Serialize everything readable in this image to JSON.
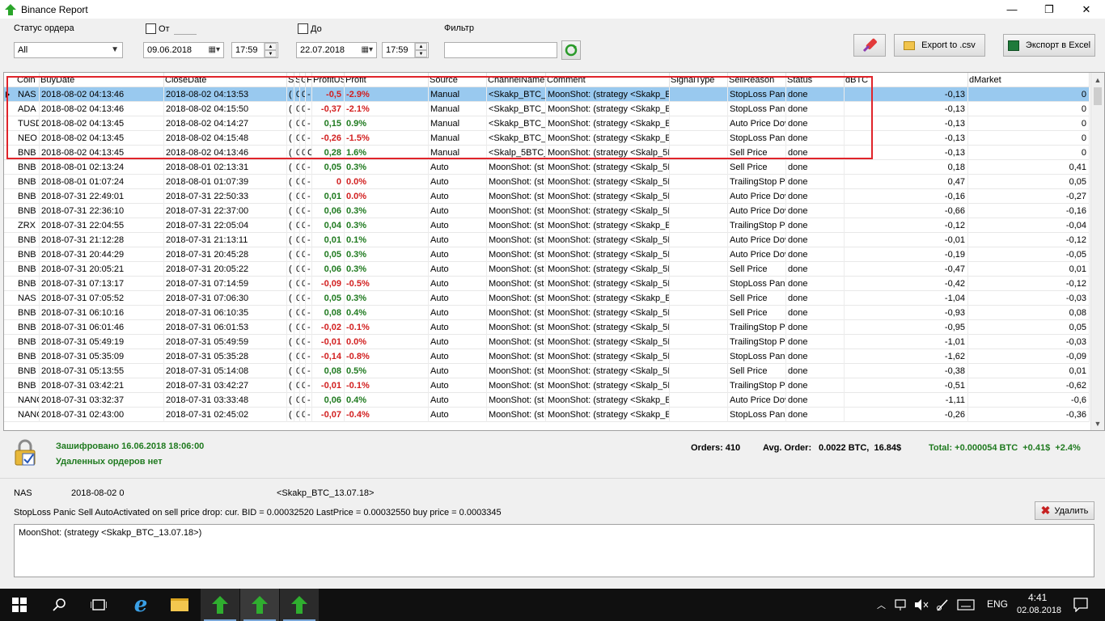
{
  "window": {
    "title": "Binance Report",
    "min_glyph": "—",
    "max_glyph": "❐",
    "close_glyph": "✕"
  },
  "toolbar": {
    "order_status_label": "Статус ордера",
    "order_status_value": "All",
    "from_label": "От",
    "from_date": "09.06.2018",
    "from_time": "17:59",
    "to_label": "До",
    "to_date": "22.07.2018",
    "to_time": "17:59",
    "filter_label": "Фильтр",
    "filter_value": "",
    "export_csv_label": "Export to .csv",
    "export_excel_label": "Экспорт в Excel"
  },
  "grid": {
    "columns": [
      "Coin",
      "BuyDate",
      "CloseDate",
      "S",
      "S",
      "G",
      "F",
      "ProfitUS",
      "Profit",
      "Source",
      "ChannelName",
      "Comment",
      "SignalType",
      "SellReason",
      "Status",
      "dBTC",
      "dMarket"
    ],
    "rows": [
      {
        "coin": "NAS",
        "buy": "2018-08-02 04:13:46",
        "close": "2018-08-02 04:13:53",
        "s1": "(",
        "s2": "0",
        "g": "0",
        "f": "-",
        "pus": "-0,5",
        "profit": "-2.9%",
        "source": "Manual",
        "channel": "<Skakp_BTC_",
        "comment": "MoonShot: (strategy <Skakp_E",
        "signal": "",
        "reason": "StopLoss Panic",
        "status": "done",
        "dbtc": "-0,13",
        "dmarket": "0",
        "sign": "neg",
        "selected": true
      },
      {
        "coin": "ADA",
        "buy": "2018-08-02 04:13:46",
        "close": "2018-08-02 04:15:50",
        "s1": "(",
        "s2": "0",
        "g": "0",
        "f": "-",
        "pus": "-0,37",
        "profit": "-2.1%",
        "source": "Manual",
        "channel": "<Skakp_BTC_",
        "comment": "MoonShot: (strategy <Skakp_E",
        "signal": "",
        "reason": "StopLoss Panic",
        "status": "done",
        "dbtc": "-0,13",
        "dmarket": "0",
        "sign": "neg"
      },
      {
        "coin": "TUSD",
        "buy": "2018-08-02 04:13:45",
        "close": "2018-08-02 04:14:27",
        "s1": "(",
        "s2": "0",
        "g": "0",
        "f": "-",
        "pus": "0,15",
        "profit": "0.9%",
        "source": "Manual",
        "channel": "<Skakp_BTC_",
        "comment": "MoonShot: (strategy <Skakp_E",
        "signal": "",
        "reason": "Auto Price Dov",
        "status": "done",
        "dbtc": "-0,13",
        "dmarket": "0",
        "sign": "pos"
      },
      {
        "coin": "NEO",
        "buy": "2018-08-02 04:13:45",
        "close": "2018-08-02 04:15:48",
        "s1": "(",
        "s2": "0",
        "g": "0",
        "f": "-",
        "pus": "-0,26",
        "profit": "-1.5%",
        "source": "Manual",
        "channel": "<Skakp_BTC_",
        "comment": "MoonShot: (strategy <Skakp_E",
        "signal": "",
        "reason": "StopLoss Panic",
        "status": "done",
        "dbtc": "-0,13",
        "dmarket": "0",
        "sign": "neg"
      },
      {
        "coin": "BNB",
        "buy": "2018-08-02 04:13:45",
        "close": "2018-08-02 04:13:46",
        "s1": "(",
        "s2": "0",
        "g": "0",
        "f": "C",
        "pus": "0,28",
        "profit": "1.6%",
        "source": "Manual",
        "channel": "<Skalp_5BTC_",
        "comment": "MoonShot: (strategy <Skalp_5I",
        "signal": "",
        "reason": "Sell Price",
        "status": "done",
        "dbtc": "-0,13",
        "dmarket": "0",
        "sign": "pos"
      },
      {
        "coin": "BNB",
        "buy": "2018-08-01 02:13:24",
        "close": "2018-08-01 02:13:31",
        "s1": "(",
        "s2": "0",
        "g": "0",
        "f": "-",
        "pus": "0,05",
        "profit": "0.3%",
        "source": "Auto",
        "channel": "MoonShot: (st",
        "comment": "MoonShot: (strategy <Skalp_5I",
        "signal": "",
        "reason": "Sell Price",
        "status": "done",
        "dbtc": "0,18",
        "dmarket": "0,41",
        "sign": "pos"
      },
      {
        "coin": "BNB",
        "buy": "2018-08-01 01:07:24",
        "close": "2018-08-01 01:07:39",
        "s1": "(",
        "s2": "0",
        "g": "0",
        "f": "-",
        "pus": "0",
        "profit": "0.0%",
        "source": "Auto",
        "channel": "MoonShot: (st",
        "comment": "MoonShot: (strategy <Skalp_5I",
        "signal": "",
        "reason": "TrailingStop Pa",
        "status": "done",
        "dbtc": "0,47",
        "dmarket": "0,05",
        "sign": "neg"
      },
      {
        "coin": "BNB",
        "buy": "2018-07-31 22:49:01",
        "close": "2018-07-31 22:50:33",
        "s1": "(",
        "s2": "0",
        "g": "0",
        "f": "-",
        "pus": "0,01",
        "profit": "0.0%",
        "source": "Auto",
        "channel": "MoonShot: (st",
        "comment": "MoonShot: (strategy <Skalp_5I",
        "signal": "",
        "reason": "Auto Price Dov",
        "status": "done",
        "dbtc": "-0,16",
        "dmarket": "-0,27",
        "sign": "pos",
        "profit_neg": true
      },
      {
        "coin": "BNB",
        "buy": "2018-07-31 22:36:10",
        "close": "2018-07-31 22:37:00",
        "s1": "(",
        "s2": "0",
        "g": "0",
        "f": "-",
        "pus": "0,06",
        "profit": "0.3%",
        "source": "Auto",
        "channel": "MoonShot: (st",
        "comment": "MoonShot: (strategy <Skalp_5I",
        "signal": "",
        "reason": "Auto Price Dov",
        "status": "done",
        "dbtc": "-0,66",
        "dmarket": "-0,16",
        "sign": "pos"
      },
      {
        "coin": "ZRX",
        "buy": "2018-07-31 22:04:55",
        "close": "2018-07-31 22:05:04",
        "s1": "(",
        "s2": "0",
        "g": "0",
        "f": "-",
        "pus": "0,04",
        "profit": "0.3%",
        "source": "Auto",
        "channel": "MoonShot: (st",
        "comment": "MoonShot: (strategy <Skakp_E",
        "signal": "",
        "reason": "TrailingStop Pa",
        "status": "done",
        "dbtc": "-0,12",
        "dmarket": "-0,04",
        "sign": "pos"
      },
      {
        "coin": "BNB",
        "buy": "2018-07-31 21:12:28",
        "close": "2018-07-31 21:13:11",
        "s1": "(",
        "s2": "0",
        "g": "0",
        "f": "-",
        "pus": "0,01",
        "profit": "0.1%",
        "source": "Auto",
        "channel": "MoonShot: (st",
        "comment": "MoonShot: (strategy <Skalp_5I",
        "signal": "",
        "reason": "Auto Price Dov",
        "status": "done",
        "dbtc": "-0,01",
        "dmarket": "-0,12",
        "sign": "pos"
      },
      {
        "coin": "BNB",
        "buy": "2018-07-31 20:44:29",
        "close": "2018-07-31 20:45:28",
        "s1": "(",
        "s2": "0",
        "g": "0",
        "f": "-",
        "pus": "0,05",
        "profit": "0.3%",
        "source": "Auto",
        "channel": "MoonShot: (st",
        "comment": "MoonShot: (strategy <Skalp_5I",
        "signal": "",
        "reason": "Auto Price Dov",
        "status": "done",
        "dbtc": "-0,19",
        "dmarket": "-0,05",
        "sign": "pos"
      },
      {
        "coin": "BNB",
        "buy": "2018-07-31 20:05:21",
        "close": "2018-07-31 20:05:22",
        "s1": "(",
        "s2": "0",
        "g": "0",
        "f": "-",
        "pus": "0,06",
        "profit": "0.3%",
        "source": "Auto",
        "channel": "MoonShot: (st",
        "comment": "MoonShot: (strategy <Skalp_5I",
        "signal": "",
        "reason": "Sell Price",
        "status": "done",
        "dbtc": "-0,47",
        "dmarket": "0,01",
        "sign": "pos"
      },
      {
        "coin": "BNB",
        "buy": "2018-07-31 07:13:17",
        "close": "2018-07-31 07:14:59",
        "s1": "(",
        "s2": "0",
        "g": "0",
        "f": "-",
        "pus": "-0,09",
        "profit": "-0.5%",
        "source": "Auto",
        "channel": "MoonShot: (st",
        "comment": "MoonShot: (strategy <Skalp_5I",
        "signal": "",
        "reason": "StopLoss Panic",
        "status": "done",
        "dbtc": "-0,42",
        "dmarket": "-0,12",
        "sign": "neg"
      },
      {
        "coin": "NAS",
        "buy": "2018-07-31 07:05:52",
        "close": "2018-07-31 07:06:30",
        "s1": "(",
        "s2": "0",
        "g": "0",
        "f": "-",
        "pus": "0,05",
        "profit": "0.3%",
        "source": "Auto",
        "channel": "MoonShot: (st",
        "comment": "MoonShot: (strategy <Skakp_E",
        "signal": "",
        "reason": "Sell Price",
        "status": "done",
        "dbtc": "-1,04",
        "dmarket": "-0,03",
        "sign": "pos"
      },
      {
        "coin": "BNB",
        "buy": "2018-07-31 06:10:16",
        "close": "2018-07-31 06:10:35",
        "s1": "(",
        "s2": "0",
        "g": "0",
        "f": "-",
        "pus": "0,08",
        "profit": "0.4%",
        "source": "Auto",
        "channel": "MoonShot: (st",
        "comment": "MoonShot: (strategy <Skalp_5I",
        "signal": "",
        "reason": "Sell Price",
        "status": "done",
        "dbtc": "-0,93",
        "dmarket": "0,08",
        "sign": "pos"
      },
      {
        "coin": "BNB",
        "buy": "2018-07-31 06:01:46",
        "close": "2018-07-31 06:01:53",
        "s1": "(",
        "s2": "0",
        "g": "0",
        "f": "-",
        "pus": "-0,02",
        "profit": "-0.1%",
        "source": "Auto",
        "channel": "MoonShot: (st",
        "comment": "MoonShot: (strategy <Skalp_5I",
        "signal": "",
        "reason": "TrailingStop Pa",
        "status": "done",
        "dbtc": "-0,95",
        "dmarket": "0,05",
        "sign": "neg"
      },
      {
        "coin": "BNB",
        "buy": "2018-07-31 05:49:19",
        "close": "2018-07-31 05:49:59",
        "s1": "(",
        "s2": "0",
        "g": "0",
        "f": "-",
        "pus": "-0,01",
        "profit": "0.0%",
        "source": "Auto",
        "channel": "MoonShot: (st",
        "comment": "MoonShot: (strategy <Skalp_5I",
        "signal": "",
        "reason": "TrailingStop Pa",
        "status": "done",
        "dbtc": "-1,01",
        "dmarket": "-0,03",
        "sign": "neg"
      },
      {
        "coin": "BNB",
        "buy": "2018-07-31 05:35:09",
        "close": "2018-07-31 05:35:28",
        "s1": "(",
        "s2": "0",
        "g": "0",
        "f": "-",
        "pus": "-0,14",
        "profit": "-0.8%",
        "source": "Auto",
        "channel": "MoonShot: (st",
        "comment": "MoonShot: (strategy <Skalp_5I",
        "signal": "",
        "reason": "StopLoss Panic",
        "status": "done",
        "dbtc": "-1,62",
        "dmarket": "-0,09",
        "sign": "neg"
      },
      {
        "coin": "BNB",
        "buy": "2018-07-31 05:13:55",
        "close": "2018-07-31 05:14:08",
        "s1": "(",
        "s2": "0",
        "g": "0",
        "f": "-",
        "pus": "0,08",
        "profit": "0.5%",
        "source": "Auto",
        "channel": "MoonShot: (st",
        "comment": "MoonShot: (strategy <Skalp_5I",
        "signal": "",
        "reason": "Sell Price",
        "status": "done",
        "dbtc": "-0,38",
        "dmarket": "0,01",
        "sign": "pos"
      },
      {
        "coin": "BNB",
        "buy": "2018-07-31 03:42:21",
        "close": "2018-07-31 03:42:27",
        "s1": "(",
        "s2": "0",
        "g": "0",
        "f": "-",
        "pus": "-0,01",
        "profit": "-0.1%",
        "source": "Auto",
        "channel": "MoonShot: (st",
        "comment": "MoonShot: (strategy <Skalp_5I",
        "signal": "",
        "reason": "TrailingStop Pa",
        "status": "done",
        "dbtc": "-0,51",
        "dmarket": "-0,62",
        "sign": "neg"
      },
      {
        "coin": "NANC",
        "buy": "2018-07-31 03:32:37",
        "close": "2018-07-31 03:33:48",
        "s1": "(",
        "s2": "0",
        "g": "0",
        "f": "-",
        "pus": "0,06",
        "profit": "0.4%",
        "source": "Auto",
        "channel": "MoonShot: (st",
        "comment": "MoonShot: (strategy <Skakp_E",
        "signal": "",
        "reason": "Auto Price Dov",
        "status": "done",
        "dbtc": "-1,11",
        "dmarket": "-0,6",
        "sign": "pos"
      },
      {
        "coin": "NANC",
        "buy": "2018-07-31 02:43:00",
        "close": "2018-07-31 02:45:02",
        "s1": "(",
        "s2": "0",
        "g": "0",
        "f": "-",
        "pus": "-0,07",
        "profit": "-0.4%",
        "source": "Auto",
        "channel": "MoonShot: (st",
        "comment": "MoonShot: (strategy <Skakp_E",
        "signal": "",
        "reason": "StopLoss Panic",
        "status": "done",
        "dbtc": "-0,26",
        "dmarket": "-0,36",
        "sign": "neg"
      }
    ]
  },
  "status": {
    "encrypted": "Зашифровано 16.06.2018 18:06:00",
    "deleted": "Удаленных ордеров нет",
    "orders_label": "Orders: 410",
    "avg_label": "Avg. Order:",
    "avg_value": "0.0022 BTC,  16.84$",
    "total": "Total: +0.000054 BTC  +0.41$  +2.4%"
  },
  "detail": {
    "coin": "NAS",
    "date": "2018-08-02 0",
    "channel": "<Skakp_BTC_13.07.18>",
    "reason_text": "StopLoss Panic Sell AutoActivated on sell price drop: cur. BID = 0.00032520 LastPrice = 0.00032550 buy price = 0.0003345",
    "delete_label": "Удалить",
    "memo": "MoonShot: (strategy <Skakp_BTC_13.07.18>)"
  },
  "taskbar": {
    "lang": "ENG",
    "time": "4:41",
    "date": "02.08.2018"
  },
  "colors": {
    "positive": "#1f7a1f",
    "negative": "#d21f1f",
    "selected_row": "#99c9ef",
    "highlight_box": "#e0242a"
  }
}
